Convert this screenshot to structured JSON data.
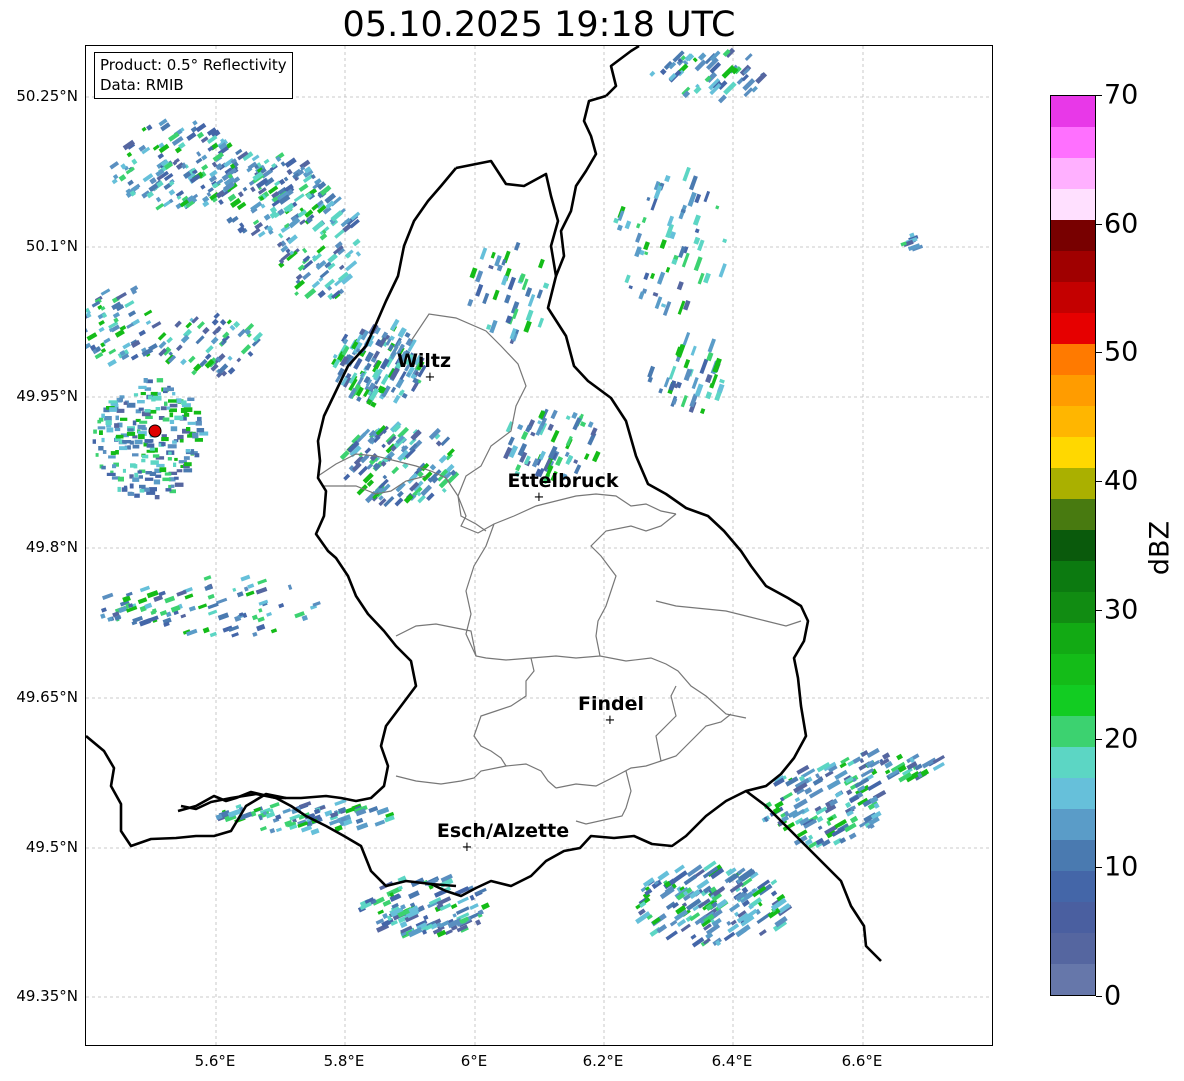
{
  "title": "05.10.2025 19:18 UTC",
  "info": {
    "product": "Product: 0.5° Reflectivity",
    "data_source": "Data: RMIB"
  },
  "latitude_labels": [
    "50.25°N",
    "50.1°N",
    "49.95°N",
    "49.8°N",
    "49.65°N",
    "49.5°N",
    "49.35°N"
  ],
  "longitude_labels": [
    "5.6°E",
    "5.8°E",
    "6°E",
    "6.2°E",
    "6.4°E",
    "6.6°E"
  ],
  "cities": [
    {
      "name": "Wiltz",
      "marker": "+"
    },
    {
      "name": "Ettelbruck",
      "marker": "+"
    },
    {
      "name": "Findel",
      "marker": "+"
    },
    {
      "name": "Esch/Alzette",
      "marker": "+"
    }
  ],
  "colorbar": {
    "label": "dBZ",
    "ticks": [
      "0",
      "10",
      "20",
      "30",
      "40",
      "50",
      "60",
      "70"
    ],
    "min": 0,
    "max": 70,
    "colors": [
      "#6677aa",
      "#5566a0",
      "#4a5fa0",
      "#4466a8",
      "#4a7ab0",
      "#5a9cc8",
      "#66c0da",
      "#5cd6c4",
      "#3cd270",
      "#12cc22",
      "#14bc18",
      "#12aa14",
      "#118c12",
      "#0c7a10",
      "#0a5a0c",
      "#487a10",
      "#aab000",
      "#ffd800",
      "#ffb600",
      "#ff9c00",
      "#ff7a00",
      "#e60000",
      "#c40000",
      "#a00000",
      "#780000",
      "#ffe0ff",
      "#ffb0ff",
      "#ff70ff",
      "#e838e8"
    ]
  },
  "radar_marker_color": "#e00000"
}
